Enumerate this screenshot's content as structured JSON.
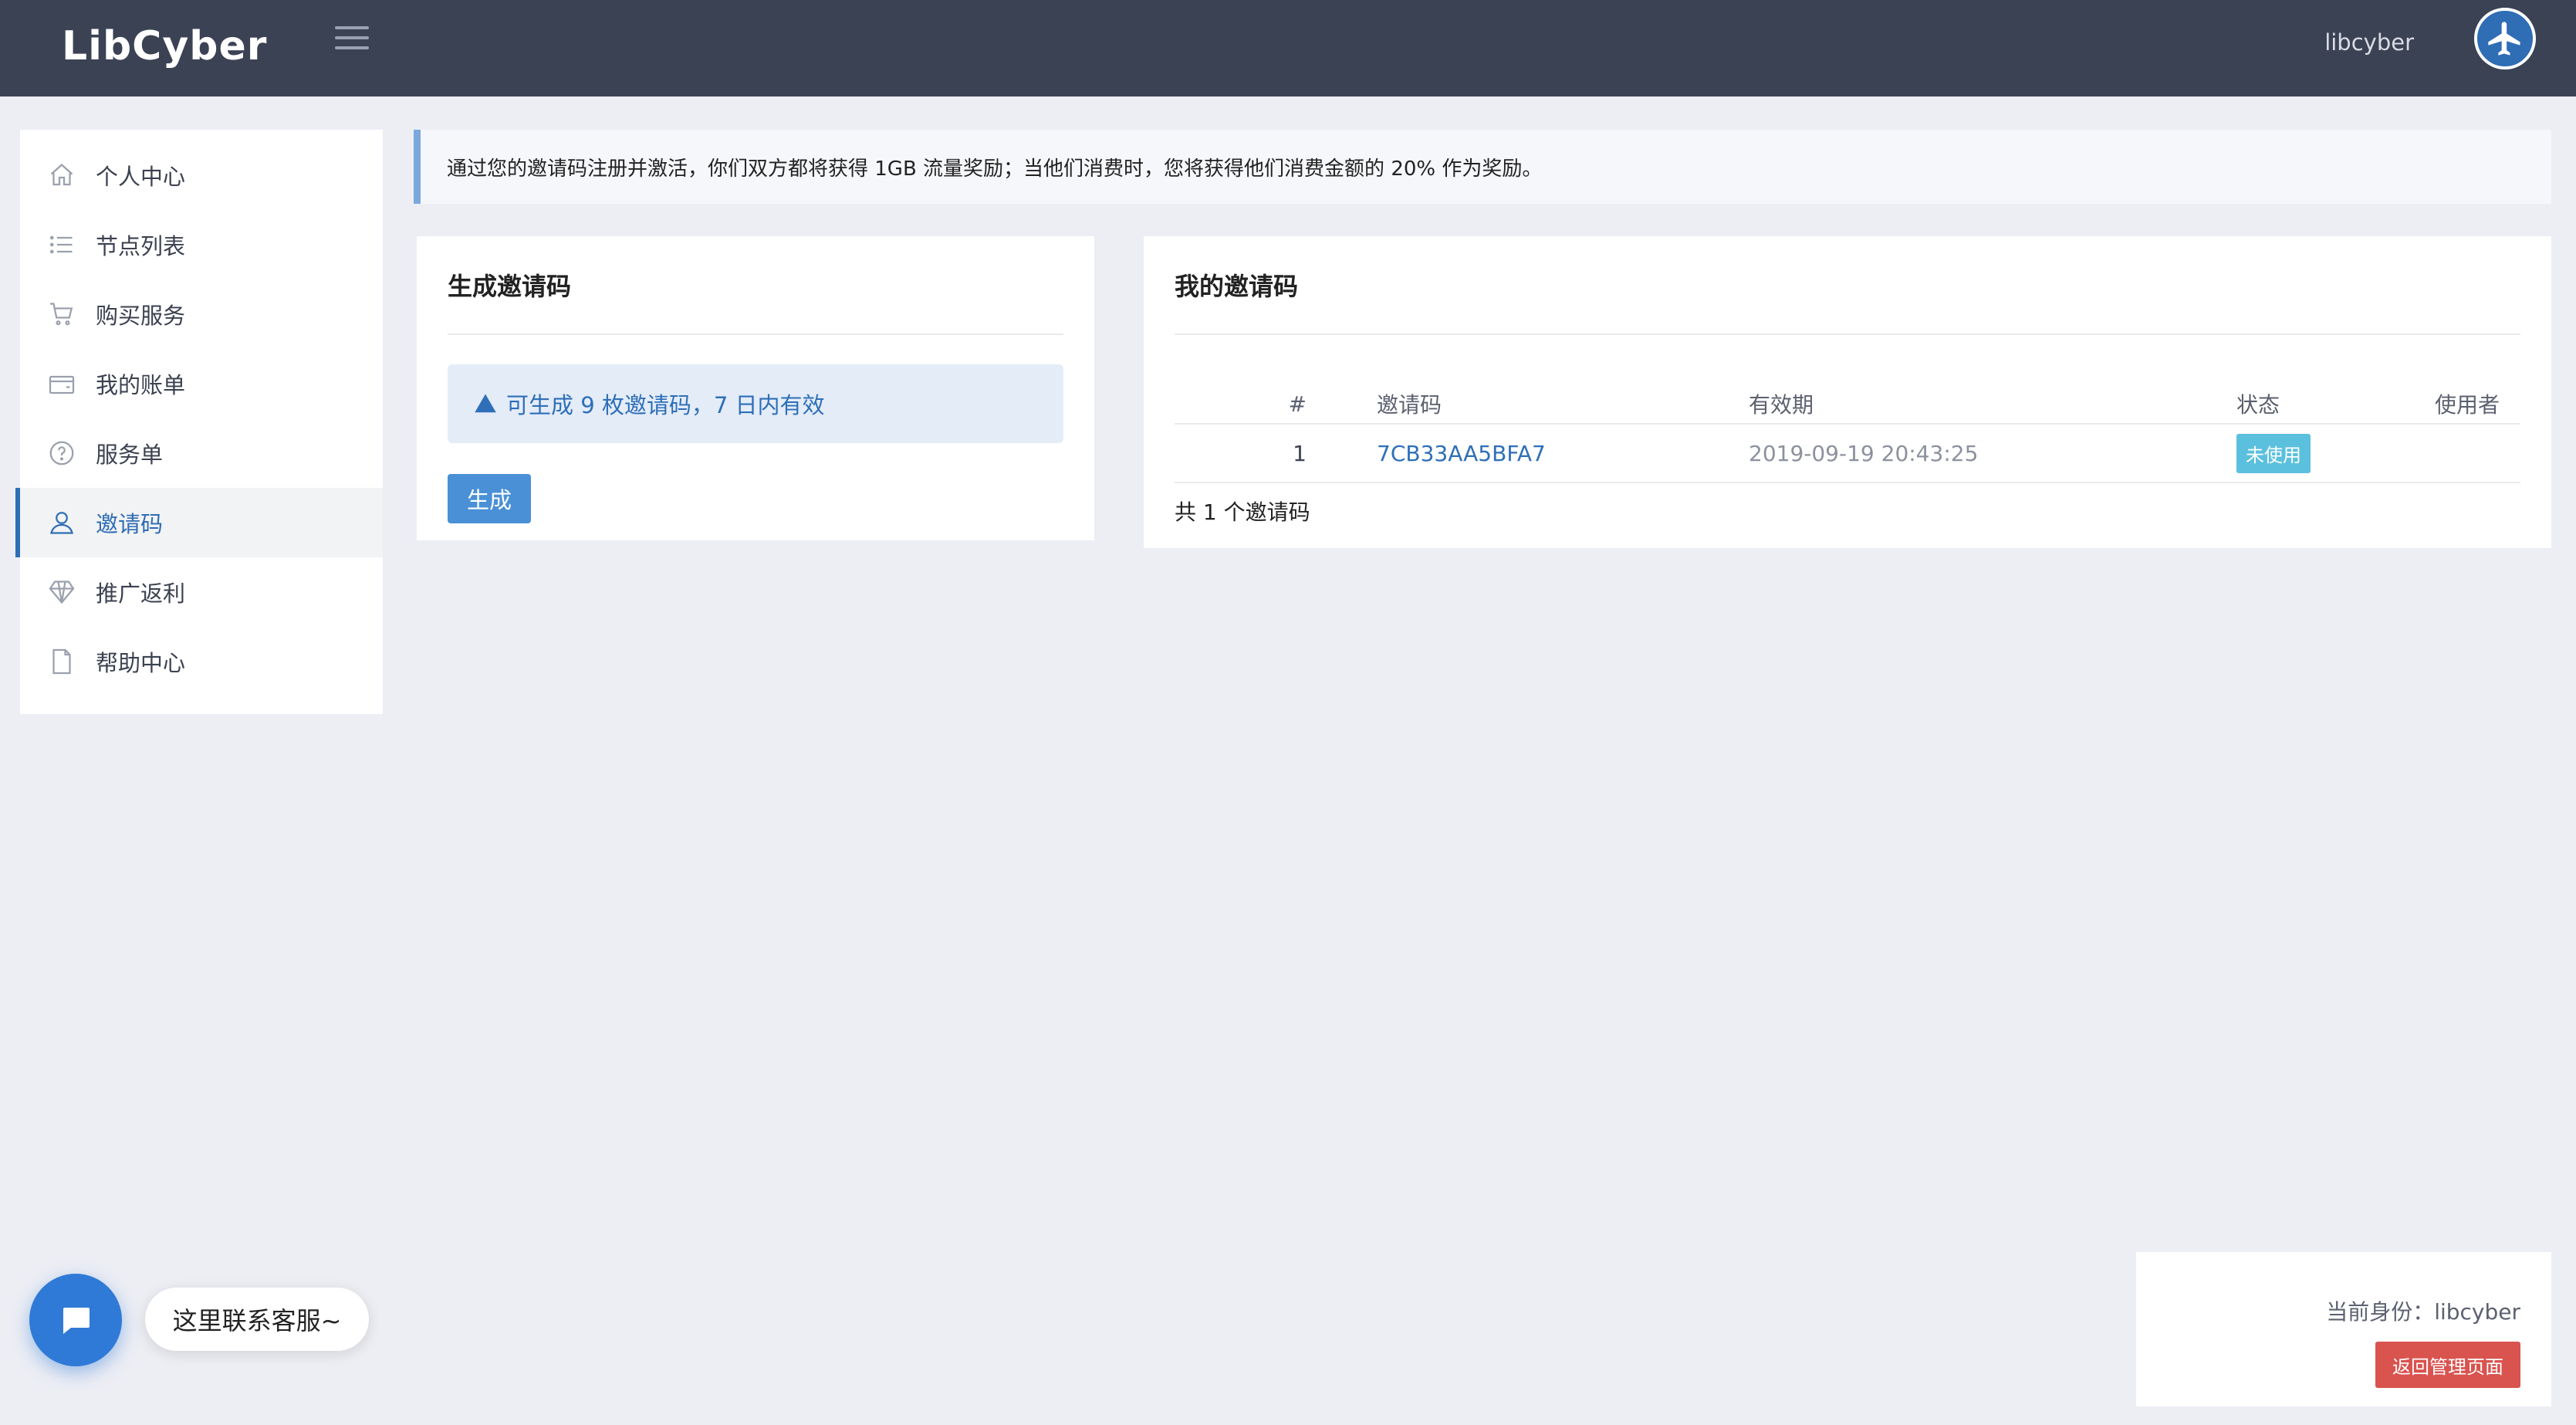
{
  "header": {
    "brand": "LibCyber",
    "username": "libcyber",
    "menu_icon": "hamburger-icon",
    "avatar_icon": "airplane-icon"
  },
  "sidebar": {
    "items": [
      {
        "label": "个人中心",
        "icon": "home-icon"
      },
      {
        "label": "节点列表",
        "icon": "list-icon"
      },
      {
        "label": "购买服务",
        "icon": "cart-icon"
      },
      {
        "label": "我的账单",
        "icon": "wallet-icon"
      },
      {
        "label": "服务单",
        "icon": "help-circle-icon"
      },
      {
        "label": "邀请码",
        "icon": "user-icon",
        "active": true
      },
      {
        "label": "推广返利",
        "icon": "diamond-icon"
      },
      {
        "label": "帮助中心",
        "icon": "document-icon"
      }
    ]
  },
  "notice": {
    "text": "通过您的邀请码注册并激活，你们双方都将获得 1GB 流量奖励；当他们消费时，您将获得他们消费金额的 20% 作为奖励。"
  },
  "generate_card": {
    "title": "生成邀请码",
    "alert_text": "可生成 9 枚邀请码，7 日内有效",
    "button_label": "生成"
  },
  "codes_card": {
    "title": "我的邀请码",
    "columns": [
      "#",
      "邀请码",
      "有效期",
      "状态",
      "使用者"
    ],
    "rows": [
      {
        "num": "1",
        "code": "7CB33AA5BFA7",
        "expires": "2019-09-19 20:43:25",
        "status": "未使用",
        "user": ""
      }
    ],
    "total": "共 1 个邀请码"
  },
  "chat": {
    "tip": "这里联系客服~"
  },
  "identity": {
    "text": "当前身份：libcyber",
    "button_label": "返回管理页面"
  },
  "colors": {
    "topbar": "#3b4254",
    "accent": "#4a90d6",
    "badge": "#5bc0de",
    "danger": "#d9534f"
  }
}
